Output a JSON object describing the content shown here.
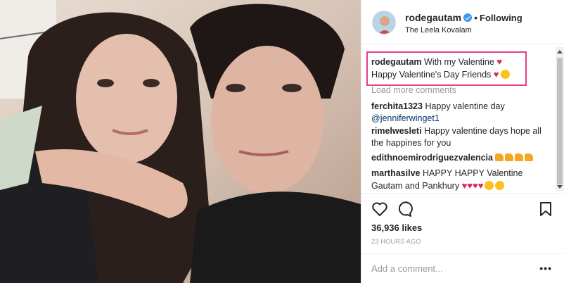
{
  "post": {
    "username": "rodegautam",
    "follow_status": "Following",
    "dot": "•",
    "location": "The Leela Kovalam"
  },
  "caption": {
    "username": "rodegautam",
    "line1": "With my Valentine",
    "line2": "Happy Valentine's Day Friends",
    "heart_icon": "red-heart-icon",
    "face_icon": "smiling-face-icon"
  },
  "load_more": "Load more comments",
  "comments": [
    {
      "user": "ferchita1323",
      "text": "Happy valentine day",
      "mention": "@jenniferwinget1"
    },
    {
      "user": "rimelwesleti",
      "text": "Happy valentine days hope all the happines for you"
    },
    {
      "user": "edithnoemirodriguezvalencia",
      "text": ""
    },
    {
      "user": "marthasilve",
      "text": "HAPPY HAPPY Valentine Gautam and Pankhury"
    }
  ],
  "likes": "36,936 likes",
  "timestamp": "23 HOURS AGO",
  "add_comment": {
    "placeholder": "Add a comment..."
  },
  "more_label": "•••",
  "icons": {
    "like": "heart-outline-icon",
    "comment": "comment-bubble-icon",
    "save": "bookmark-icon"
  },
  "colors": {
    "verified": "#3897f0",
    "highlight_border": "#e4418a",
    "heart": "#e0245e"
  }
}
